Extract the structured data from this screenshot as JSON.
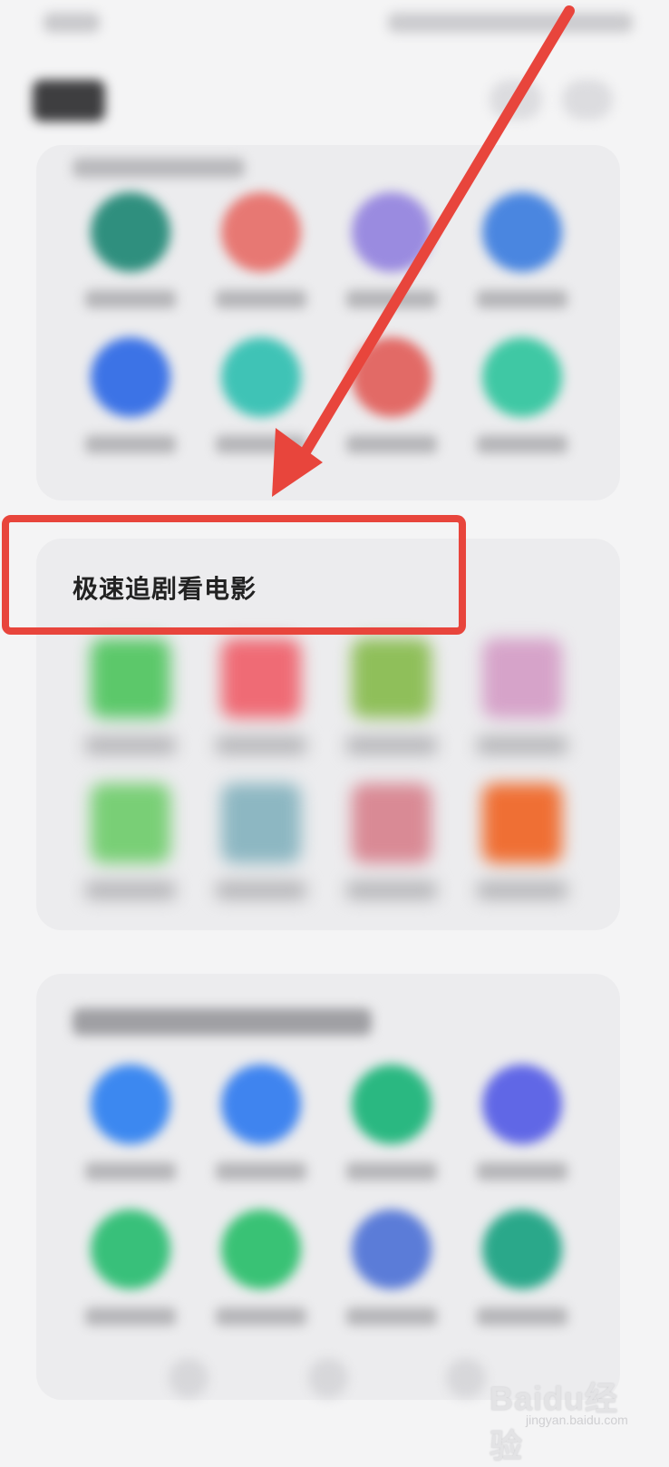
{
  "highlighted_section": {
    "title": "极速追剧看电影"
  },
  "watermark": {
    "brand": "Baidu",
    "product": "经验",
    "url": "jingyan.baidu.com"
  },
  "annotation": {
    "arrow_color": "#e8453c",
    "box_color": "#e8453c"
  },
  "card_1": {
    "apps": [
      {
        "icon": "app-icon",
        "color": "#2f8f7e"
      },
      {
        "icon": "app-icon",
        "color": "#e77873"
      },
      {
        "icon": "app-icon",
        "color": "#9a8be0"
      },
      {
        "icon": "app-icon",
        "color": "#4a86e0"
      },
      {
        "icon": "app-icon",
        "color": "#3c73e6"
      },
      {
        "icon": "app-icon",
        "color": "#3fc3b6"
      },
      {
        "icon": "app-icon",
        "color": "#e26a66"
      },
      {
        "icon": "app-icon",
        "color": "#3fc8a4"
      }
    ]
  },
  "card_2": {
    "apps": [
      {
        "icon": "app-icon",
        "color": "#5cc86a"
      },
      {
        "icon": "app-icon",
        "color": "#ef6b75"
      },
      {
        "icon": "app-icon",
        "color": "#8fbf5a"
      },
      {
        "icon": "app-icon",
        "color": "#d6a3c9"
      },
      {
        "icon": "app-icon",
        "color": "#79cf76"
      },
      {
        "icon": "app-icon",
        "color": "#8db7c2"
      },
      {
        "icon": "app-icon",
        "color": "#d98a95"
      },
      {
        "icon": "app-icon",
        "color": "#ef6f34"
      }
    ]
  },
  "card_3": {
    "apps": [
      {
        "icon": "app-icon",
        "color": "#3c88f0"
      },
      {
        "icon": "app-icon",
        "color": "#3f84ef"
      },
      {
        "icon": "app-icon",
        "color": "#2ab881"
      },
      {
        "icon": "app-icon",
        "color": "#6067e6"
      },
      {
        "icon": "app-icon",
        "color": "#38c07a"
      },
      {
        "icon": "app-icon",
        "color": "#39c275"
      },
      {
        "icon": "app-icon",
        "color": "#5b7cd8"
      },
      {
        "icon": "app-icon",
        "color": "#2aa88a"
      }
    ]
  }
}
